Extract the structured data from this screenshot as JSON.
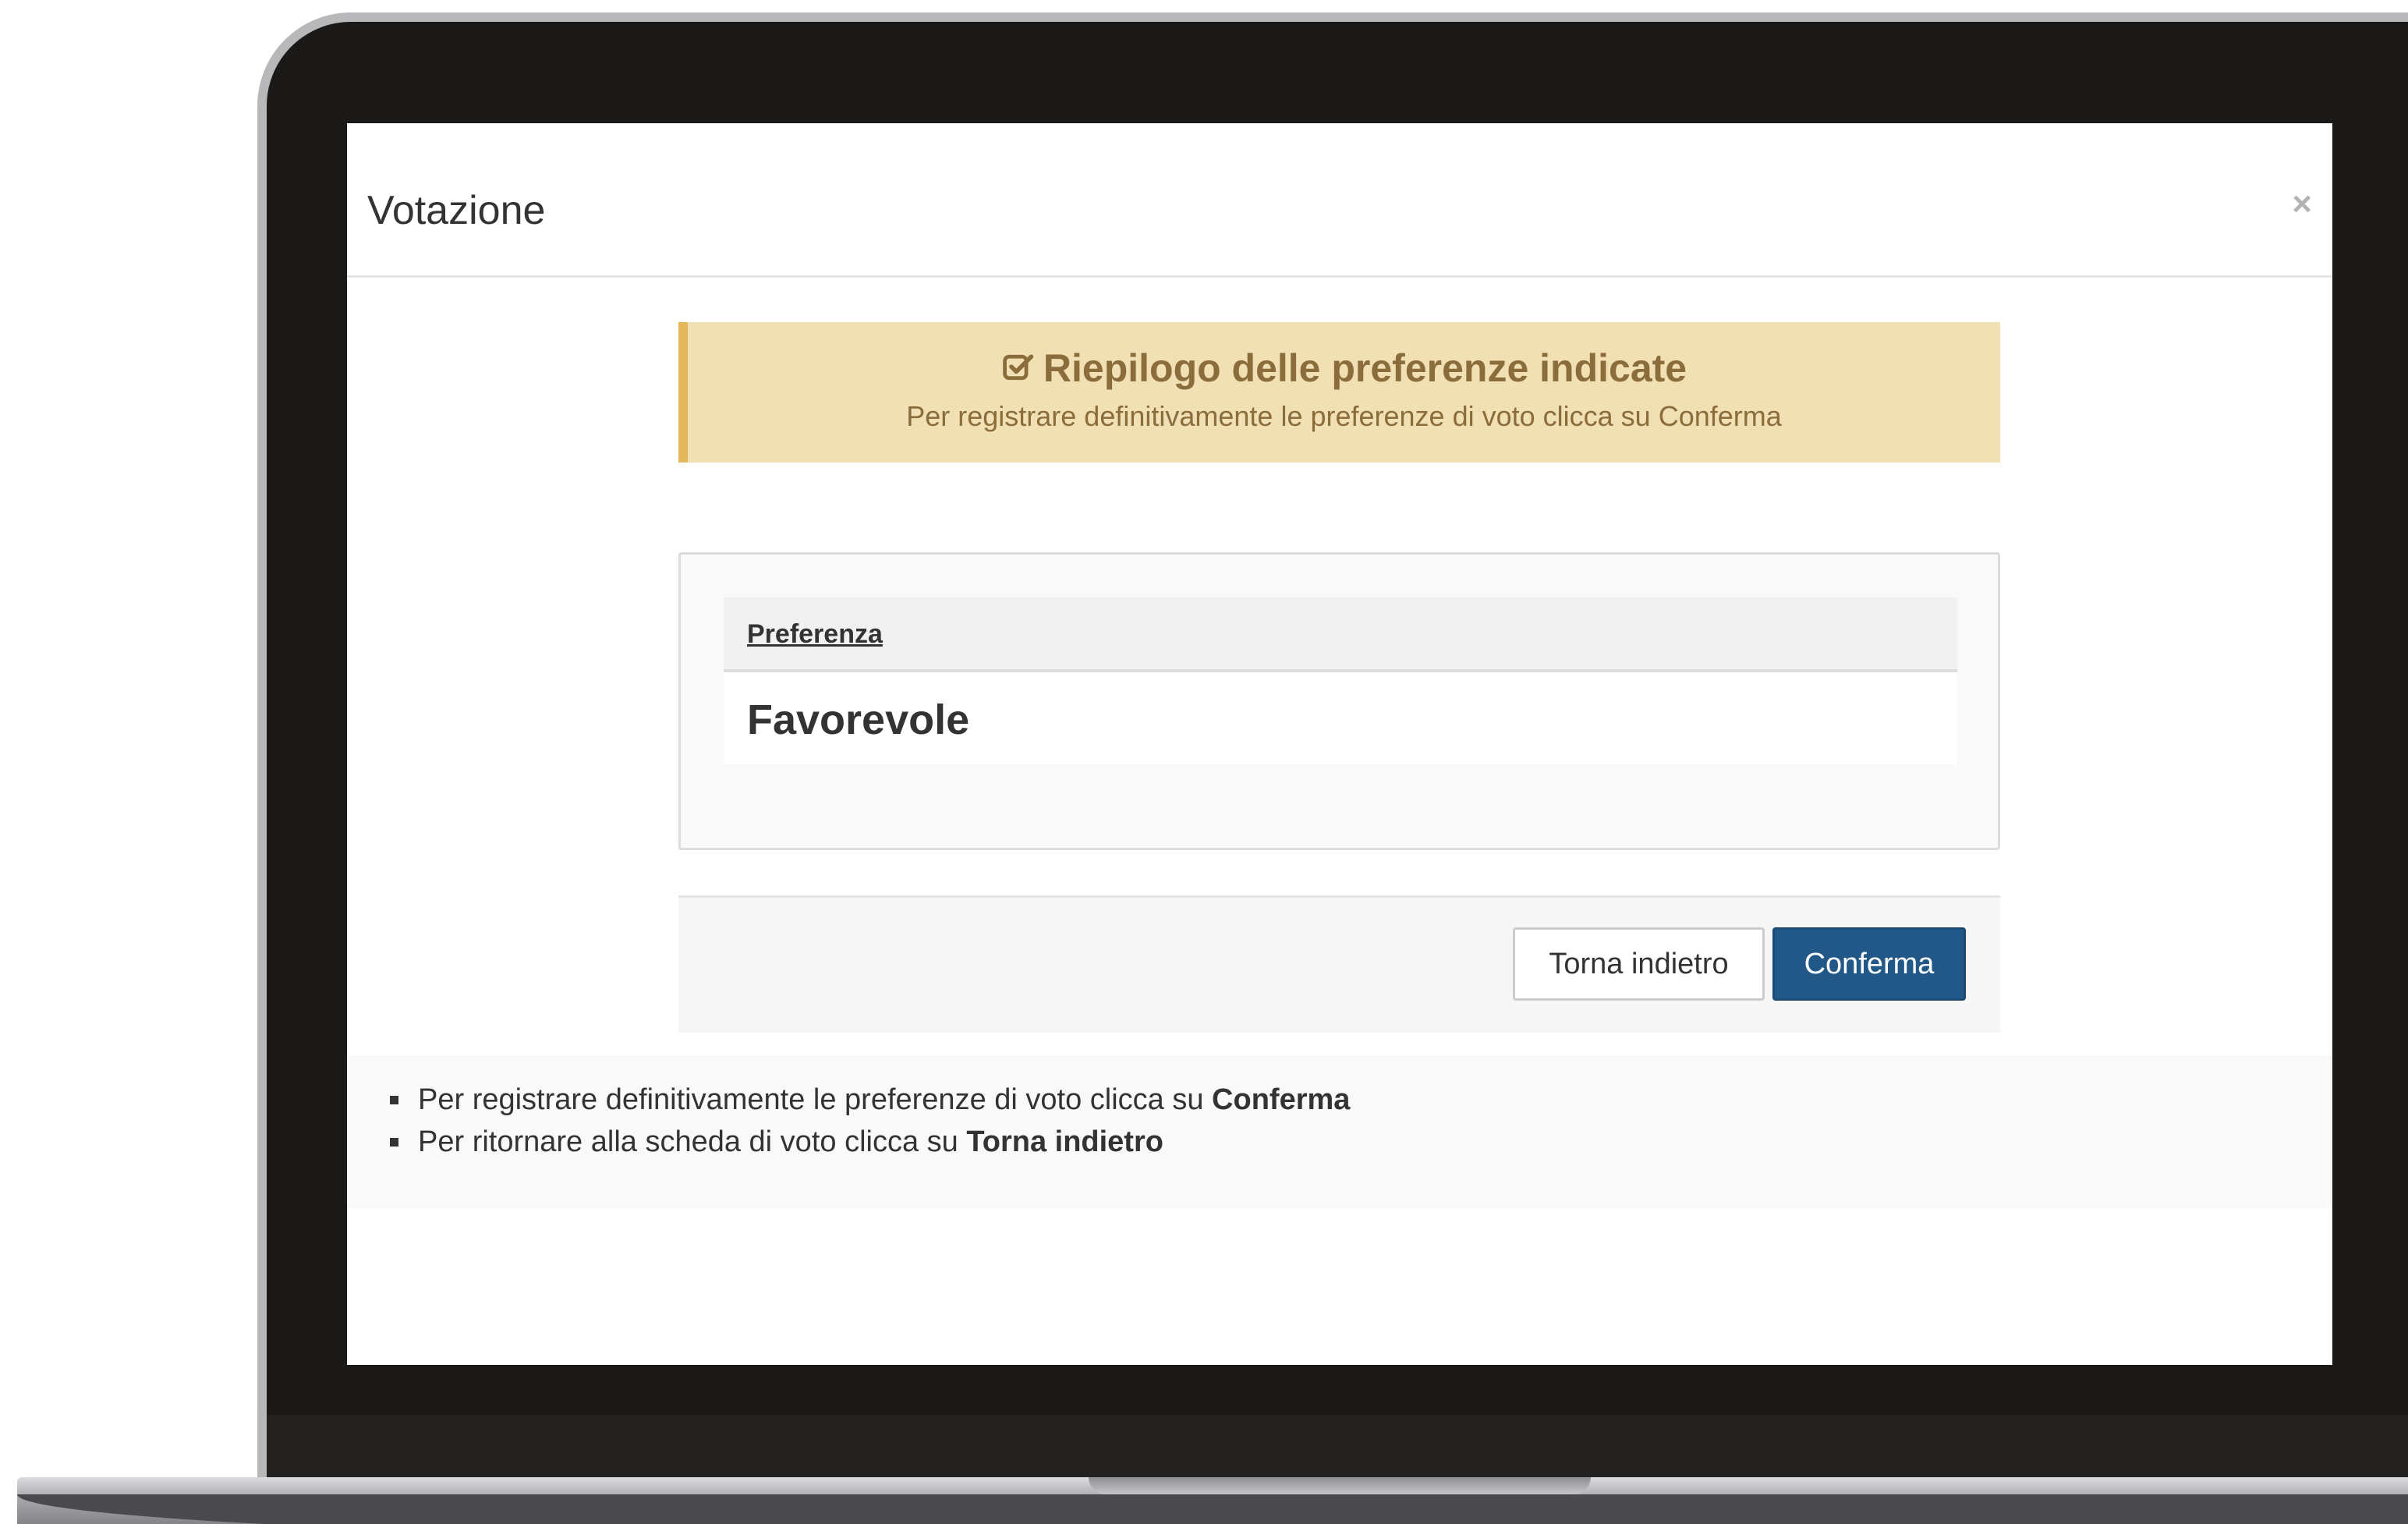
{
  "modal": {
    "title": "Votazione",
    "close_label": "×"
  },
  "alert": {
    "icon": "check-square-icon",
    "title": "Riepilogo delle preferenze indicate",
    "subtitle": "Per registrare definitivamente le preferenze di voto clicca su Conferma"
  },
  "preference": {
    "header": "Preferenza",
    "value": "Favorevole"
  },
  "buttons": {
    "back_label": "Torna indietro",
    "confirm_label": "Conferma"
  },
  "notes": [
    {
      "text": "Per registrare definitivamente le preferenze di voto clicca su ",
      "bold": "Conferma"
    },
    {
      "text": "Per ritornare alla scheda di voto clicca su ",
      "bold": "Torna indietro"
    }
  ],
  "colors": {
    "alert_bg": "#f2e0b5",
    "alert_border": "#e5b85c",
    "alert_text": "#8a6d3b",
    "primary_button": "#215888"
  }
}
